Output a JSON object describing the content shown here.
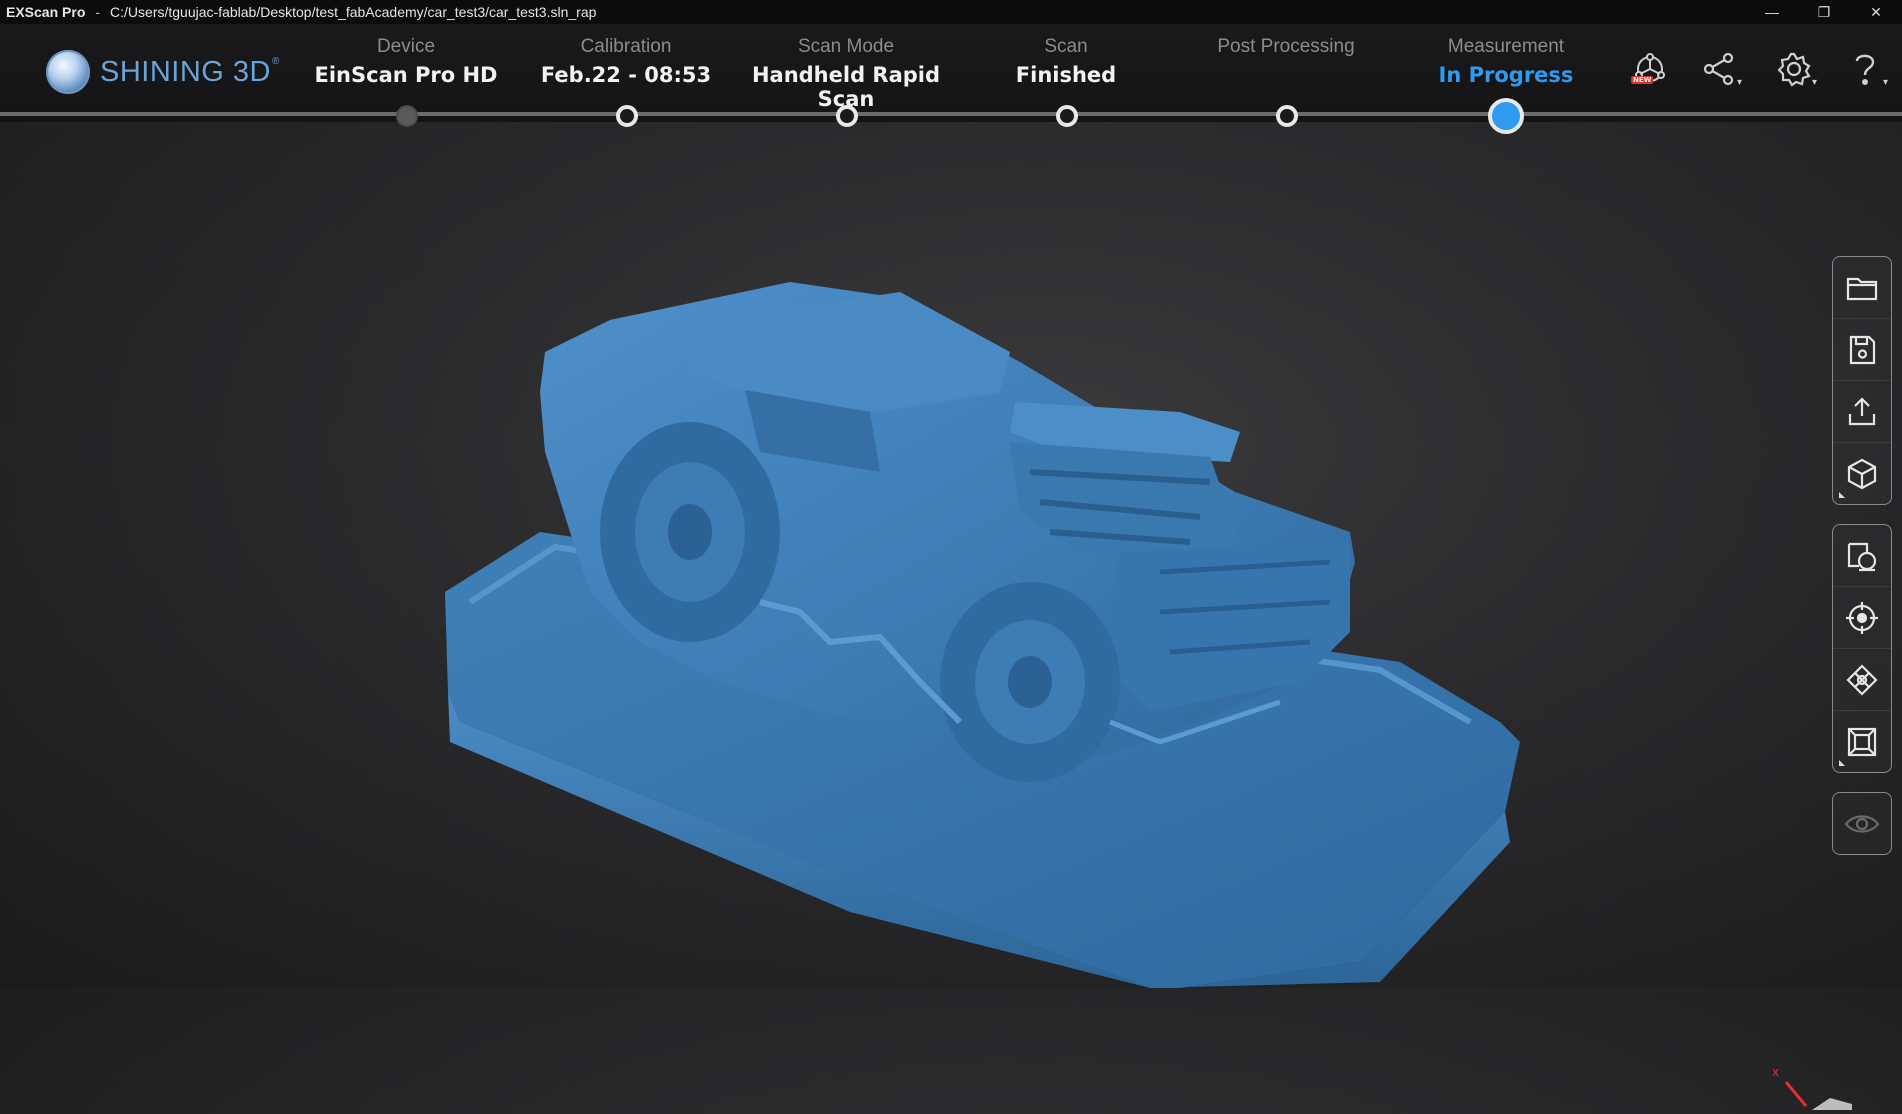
{
  "titlebar": {
    "app_name": "EXScan Pro",
    "separator": "-",
    "path": "C:/Users/tguujac-fablab/Desktop/test_fabAcademy/car_test3/car_test3.sln_rap",
    "minimize": "—",
    "restore": "❐",
    "close": "✕"
  },
  "header": {
    "logo_text": "SHINING 3D",
    "logo_mark": "®",
    "steps": [
      {
        "label": "Device",
        "value": "EinScan Pro HD"
      },
      {
        "label": "Calibration",
        "value": "Feb.22 - 08:53"
      },
      {
        "label": "Scan Mode",
        "value": "Handheld Rapid Scan"
      },
      {
        "label": "Scan",
        "value": "Finished"
      },
      {
        "label": "Post Processing",
        "value": ""
      },
      {
        "label": "Measurement",
        "value": "In Progress"
      }
    ],
    "new_badge": "NEW",
    "caret": "▾"
  },
  "viewport": {
    "axis_label": "x"
  },
  "colors": {
    "accent": "#2e9bf0",
    "model": "#3a78b0",
    "background": "#2a2a2d"
  },
  "toolbar_icons": [
    "folder-icon",
    "save-icon",
    "export-icon",
    "cube-icon",
    "align-icon",
    "target-icon",
    "merge-icon",
    "frame-icon",
    "eye-icon"
  ]
}
